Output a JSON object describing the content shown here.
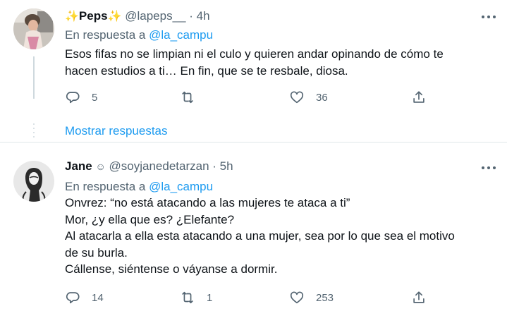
{
  "tweets": [
    {
      "display_name": "Peps",
      "name_prefix_emoji": "✨",
      "name_suffix_emoji": "✨",
      "handle": "@lapeps__",
      "separator": "·",
      "time": "4h",
      "replying_prefix": "En respuesta a",
      "replying_to": "@la_campu",
      "lines": [
        "Esos fifas no se limpian ni el culo y quieren andar opinando de cómo te",
        "hacen estudios a ti… En fin, que se te resbale, diosa."
      ],
      "replies": "5",
      "retweets": "",
      "likes": "36",
      "show_replies": "Mostrar respuestas"
    },
    {
      "display_name": "Jane",
      "badge": "☺",
      "handle": "@soyjanedetarzan",
      "separator": "·",
      "time": "5h",
      "replying_prefix": "En respuesta a",
      "replying_to": "@la_campu",
      "lines": [
        "Onvrez: “no está atacando a las mujeres te ataca a ti”",
        "Mor, ¿y ella que es? ¿Elefante?",
        "Al atacarla a ella esta atacando a una mujer, sea por lo que sea el motivo",
        "de su burla.",
        "Cállense, siéntense o váyanse a dormir."
      ],
      "replies": "14",
      "retweets": "1",
      "likes": "253"
    }
  ],
  "colors": {
    "link": "#1d9bf0",
    "secondary_text": "#536471",
    "primary_text": "#0f1419",
    "divider": "#eff3f4"
  }
}
